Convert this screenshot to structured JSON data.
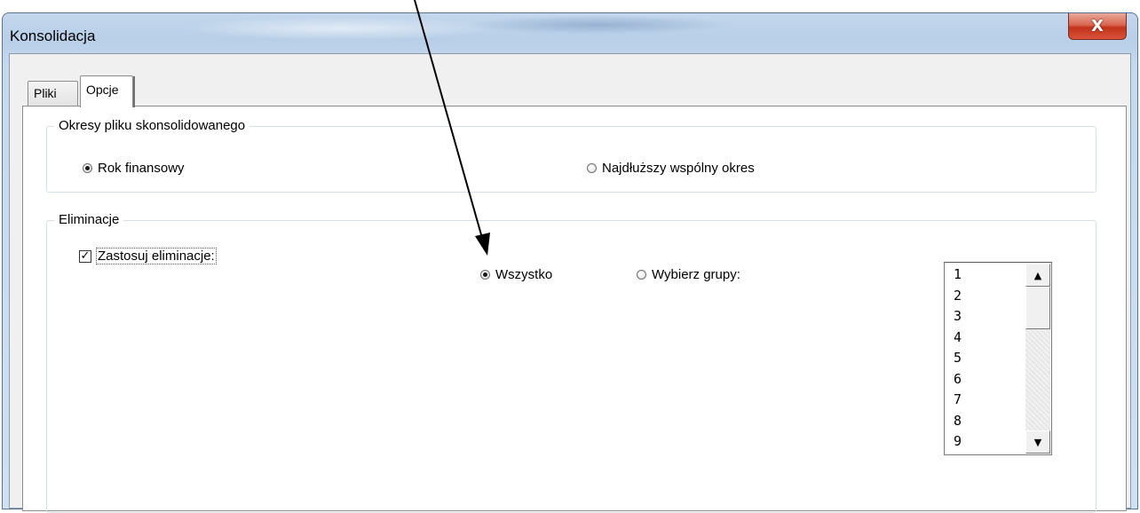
{
  "window": {
    "title": "Konsolidacja",
    "close_label": "X"
  },
  "tabs": [
    {
      "label": "Pliki",
      "selected": false
    },
    {
      "label": "Opcje",
      "selected": true
    }
  ],
  "okresy": {
    "title": "Okresy pliku skonsolidowanego",
    "options": [
      {
        "label": "Rok finansowy",
        "selected": true
      },
      {
        "label": "Najdłuższy wspólny okres",
        "selected": false
      }
    ]
  },
  "eliminacje": {
    "title": "Eliminacje",
    "apply_label": "Zastosuj eliminacje:",
    "apply_checked": true,
    "scope_options": [
      {
        "label": "Wszystko",
        "selected": true
      },
      {
        "label": "Wybierz grupy:",
        "selected": false
      }
    ],
    "groups": [
      "1",
      "2",
      "3",
      "4",
      "5",
      "6",
      "7",
      "8",
      "9"
    ]
  },
  "colors": {
    "close_button": "#c7452c",
    "arrow": "#000000"
  }
}
